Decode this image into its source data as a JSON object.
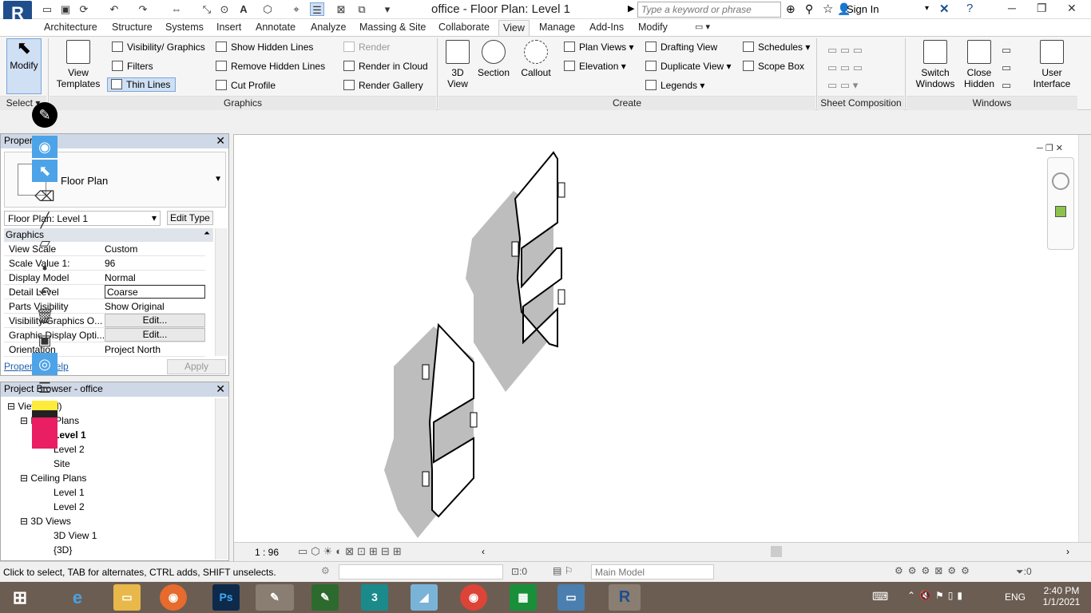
{
  "app": {
    "logo": "R",
    "title": "office - Floor Plan: Level 1"
  },
  "qat": {
    "icons": [
      "open-icon",
      "save-icon",
      "sync-icon",
      "undo-icon",
      "redo-icon",
      "measure-icon",
      "dimension-icon",
      "tag-icon",
      "text-icon",
      "3d-icon",
      "section-icon",
      "thin-lines-icon",
      "close-hidden-icon",
      "switch-windows-icon",
      "dropdown-icon"
    ]
  },
  "search": {
    "placeholder": "Type a keyword or phrase"
  },
  "account": {
    "signin": "Sign In"
  },
  "tabs": [
    "Architecture",
    "Structure",
    "Systems",
    "Insert",
    "Annotate",
    "Analyze",
    "Massing & Site",
    "Collaborate",
    "View",
    "Manage",
    "Add-Ins",
    "Modify"
  ],
  "active_tab": "View",
  "ribbon": {
    "modify": "Modify",
    "select": "Select",
    "view_templates": "View Templates",
    "visibility": "Visibility/ Graphics",
    "filters": "Filters",
    "thin_lines": "Thin Lines",
    "show_hidden": "Show Hidden Lines",
    "remove_hidden": "Remove Hidden Lines",
    "cut_profile": "Cut Profile",
    "render": "Render",
    "render_cloud": "Render in Cloud",
    "render_gallery": "Render Gallery",
    "graphics_panel": "Graphics",
    "view3d": "3D View",
    "section": "Section",
    "callout": "Callout",
    "plan_views": "Plan Views",
    "elevation": "Elevation",
    "drafting_view": "Drafting View",
    "duplicate_view": "Duplicate View",
    "legends": "Legends",
    "schedules": "Schedules",
    "scope_box": "Scope Box",
    "create_panel": "Create",
    "sheet_panel": "Sheet Composition",
    "switch_windows": "Switch Windows",
    "close_hidden": "Close Hidden",
    "user_interface": "User Interface",
    "windows_panel": "Windows"
  },
  "properties": {
    "title": "Properties",
    "type": "Floor Plan",
    "instance": "Floor Plan: Level 1",
    "edit_type": "Edit Type",
    "group": "Graphics",
    "rows": [
      {
        "k": "View Scale",
        "v": "Custom"
      },
      {
        "k": "Scale Value 1:",
        "v": "96"
      },
      {
        "k": "Display Model",
        "v": "Normal"
      },
      {
        "k": "Detail Level",
        "v": "Coarse"
      },
      {
        "k": "Parts Visibility",
        "v": "Show Original"
      },
      {
        "k": "Visibility/Graphics O...",
        "v": "Edit..."
      },
      {
        "k": "Graphic Display Opti...",
        "v": "Edit..."
      },
      {
        "k": "Orientation",
        "v": "Project North"
      }
    ],
    "help": "Properties help",
    "apply": "Apply"
  },
  "browser": {
    "title": "Project Browser - office",
    "nodes": [
      {
        "label": "Views (all)",
        "level": 0
      },
      {
        "label": "Floor Plans",
        "level": 1
      },
      {
        "label": "Level 1",
        "level": 2
      },
      {
        "label": "Level 2",
        "level": 2
      },
      {
        "label": "Site",
        "level": 2
      },
      {
        "label": "Ceiling Plans",
        "level": 1
      },
      {
        "label": "Level 1",
        "level": 2
      },
      {
        "label": "Level 2",
        "level": 2
      },
      {
        "label": "3D Views",
        "level": 1
      },
      {
        "label": "3D View 1",
        "level": 2
      },
      {
        "label": "{3D}",
        "level": 2
      }
    ]
  },
  "view": {
    "scale": "1 : 96"
  },
  "status": {
    "message": "Click to select, TAB for alternates, CTRL adds, SHIFT unselects.",
    "selection": ":0",
    "model": "Main Model",
    "filter": ":0"
  },
  "taskbar": {
    "apps": [
      "start",
      "edge",
      "explorer",
      "firefox",
      "photoshop",
      "pen-tool",
      "scratch",
      "3dsmax",
      "app",
      "chrome",
      "calculator",
      "photos",
      "revit"
    ],
    "lang": "ENG",
    "time": "2:40 PM",
    "date": "1/1/2021"
  },
  "colors": {
    "accent": "#1f4e8c",
    "tab_active": "#f5f5f5",
    "ribbon_bg": "#f5f5f5",
    "taskbar": "#6b5d52"
  }
}
